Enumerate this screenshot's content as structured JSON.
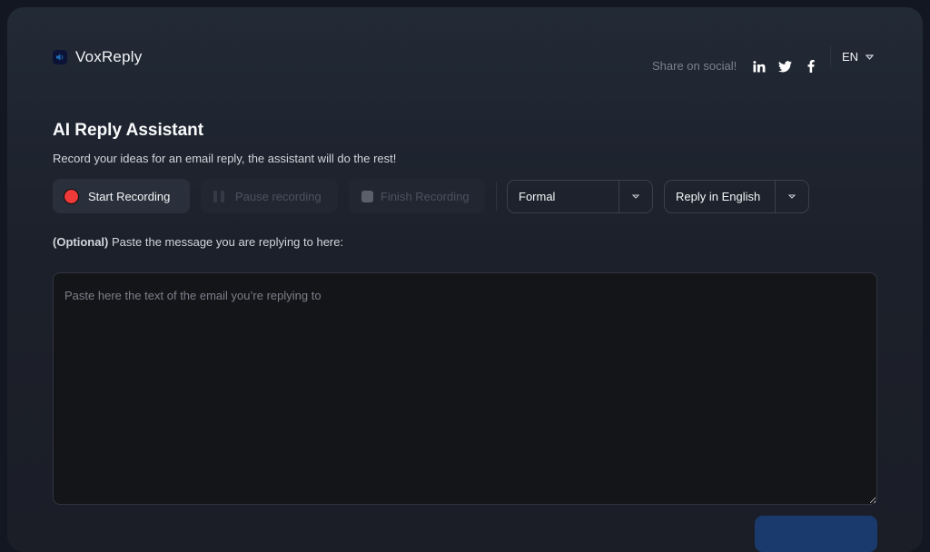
{
  "app": {
    "name": "VoxReply"
  },
  "header": {
    "share_text": "Share on social!",
    "social_icons": [
      "linkedin-icon",
      "twitter-icon",
      "facebook-icon"
    ],
    "language": "EN"
  },
  "main": {
    "title": "AI Reply Assistant",
    "subtitle": "Record your ideas for an email reply, the assistant will do the rest!",
    "controls": {
      "start_label": "Start Recording",
      "pause_label": "Pause recording",
      "finish_label": "Finish Recording"
    },
    "tone_select": {
      "value": "Formal"
    },
    "language_select": {
      "value": "Reply in English"
    },
    "optional_prefix": "(Optional)",
    "optional_text": " Paste the message you are replying to here:",
    "textarea": {
      "value": "",
      "placeholder": "Paste here the text of the email you’re replying to"
    }
  },
  "colors": {
    "record": "#ef3a3a",
    "accent": "#1a3a6e",
    "background": "#1c202a"
  }
}
